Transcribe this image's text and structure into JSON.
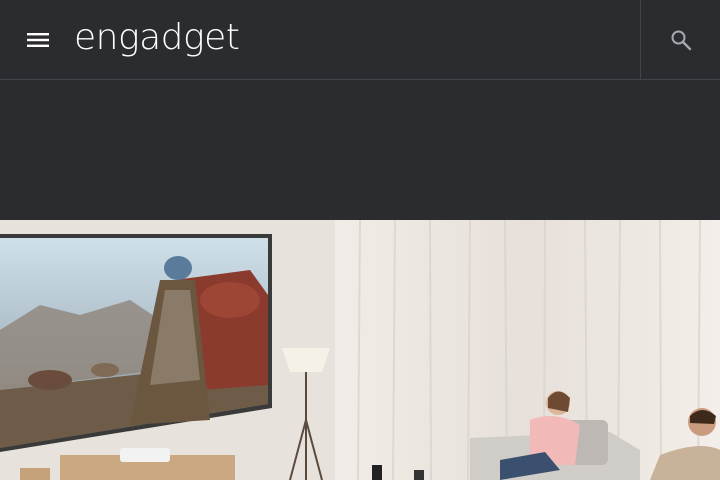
{
  "header": {
    "logo_text": "engadget",
    "menu_icon": "hamburger-menu-icon",
    "search_icon": "search-icon"
  },
  "hero": {
    "description": "",
    "colors": {
      "wall": "#e9e3de",
      "curtain": "#efe9e4",
      "floor": "#d9cfc6"
    }
  }
}
